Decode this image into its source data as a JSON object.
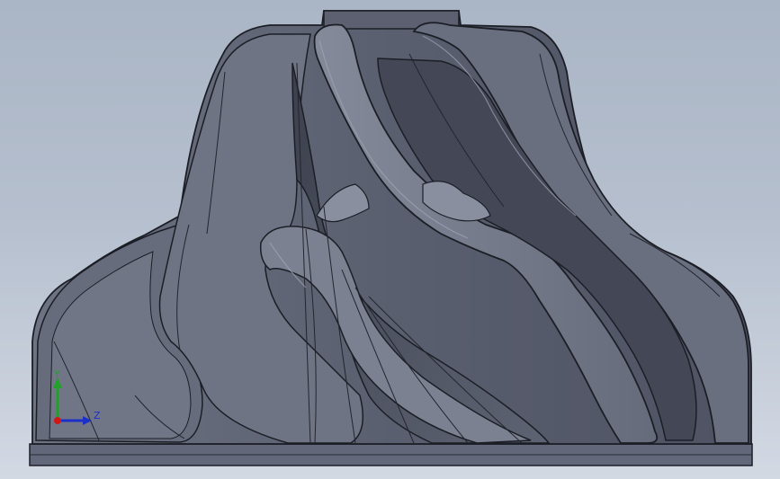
{
  "viewport": {
    "background_top": "#aab5c5",
    "background_bottom": "#d3d9e3"
  },
  "model": {
    "body_color": "#5d6272",
    "light_face_color": "#7a7f8f",
    "dark_face_color": "#3e4250",
    "edge_color": "#1c1e26"
  },
  "triad": {
    "y_label": "Y",
    "z_label": "Z",
    "y_color": "#1fa12a",
    "z_color": "#1b2fc9",
    "x_color": "#d01818"
  }
}
